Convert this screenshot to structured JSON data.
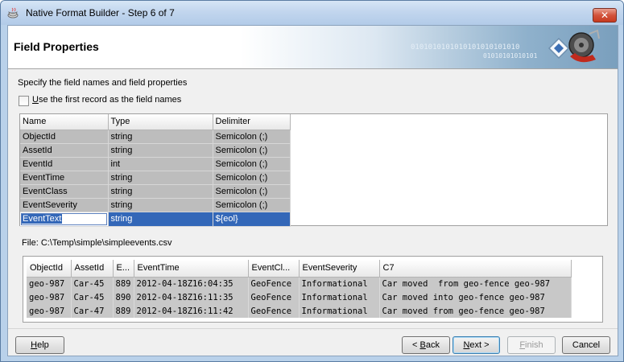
{
  "window": {
    "title": "Native Format Builder - Step 6 of 7",
    "close_glyph": "✕"
  },
  "header": {
    "title": "Field Properties",
    "binary_line1": "0101010101010101010101010",
    "binary_line2": "01010101010101"
  },
  "instructions": "Specify the field names and field properties",
  "first_record_checkbox": {
    "label_prefix": "U",
    "label_rest": "se the first record as the field names",
    "checked": false
  },
  "fields_table": {
    "columns": [
      "Name",
      "Type",
      "Delimiter"
    ],
    "rows": [
      {
        "name": "ObjectId",
        "type": "string",
        "delimiter": "Semicolon (;)"
      },
      {
        "name": "AssetId",
        "type": "string",
        "delimiter": "Semicolon (;)"
      },
      {
        "name": "EventId",
        "type": "int",
        "delimiter": "Semicolon (;)"
      },
      {
        "name": "EventTime",
        "type": "string",
        "delimiter": "Semicolon (;)"
      },
      {
        "name": "EventClass",
        "type": "string",
        "delimiter": "Semicolon (;)"
      },
      {
        "name": "EventSeverity",
        "type": "string",
        "delimiter": "Semicolon (;)"
      },
      {
        "name": "EventText",
        "type": "string",
        "delimiter": "${eol}"
      }
    ]
  },
  "file_path": "File: C:\\Temp\\simple\\simpleevents.csv",
  "preview_table": {
    "columns": [
      "ObjectId",
      "AssetId",
      "E...",
      "EventTime",
      "EventCl...",
      "EventSeverity",
      "C7"
    ],
    "rows": [
      [
        "geo-987",
        "Car-45",
        "889",
        "2012-04-18Z16:04:35",
        "GeoFence",
        "Informational",
        "Car moved  from geo-fence geo-987"
      ],
      [
        "geo-987",
        "Car-45",
        "890",
        "2012-04-18Z16:11:35",
        "GeoFence",
        "Informational",
        "Car moved into geo-fence geo-987"
      ],
      [
        "geo-987",
        "Car-47",
        "889",
        "2012-04-18Z16:11:42",
        "GeoFence",
        "Informational",
        "Car moved from geo-fence geo-987"
      ]
    ]
  },
  "buttons": {
    "help": {
      "prefix": "",
      "mnemonic": "H",
      "rest": "elp"
    },
    "back": {
      "prefix": "< ",
      "mnemonic": "B",
      "rest": "ack"
    },
    "next": {
      "prefix": "",
      "mnemonic": "N",
      "rest": "ext >"
    },
    "finish": {
      "prefix": "",
      "mnemonic": "F",
      "rest": "inish"
    },
    "cancel": {
      "label": "Cancel"
    }
  },
  "colors": {
    "selection": "#3367b8",
    "row_background": "#bdbdbd",
    "title_bar": "#c2d6ee"
  },
  "icons": {
    "app": "java-cup-icon",
    "header": "builder-wizard-icon"
  }
}
